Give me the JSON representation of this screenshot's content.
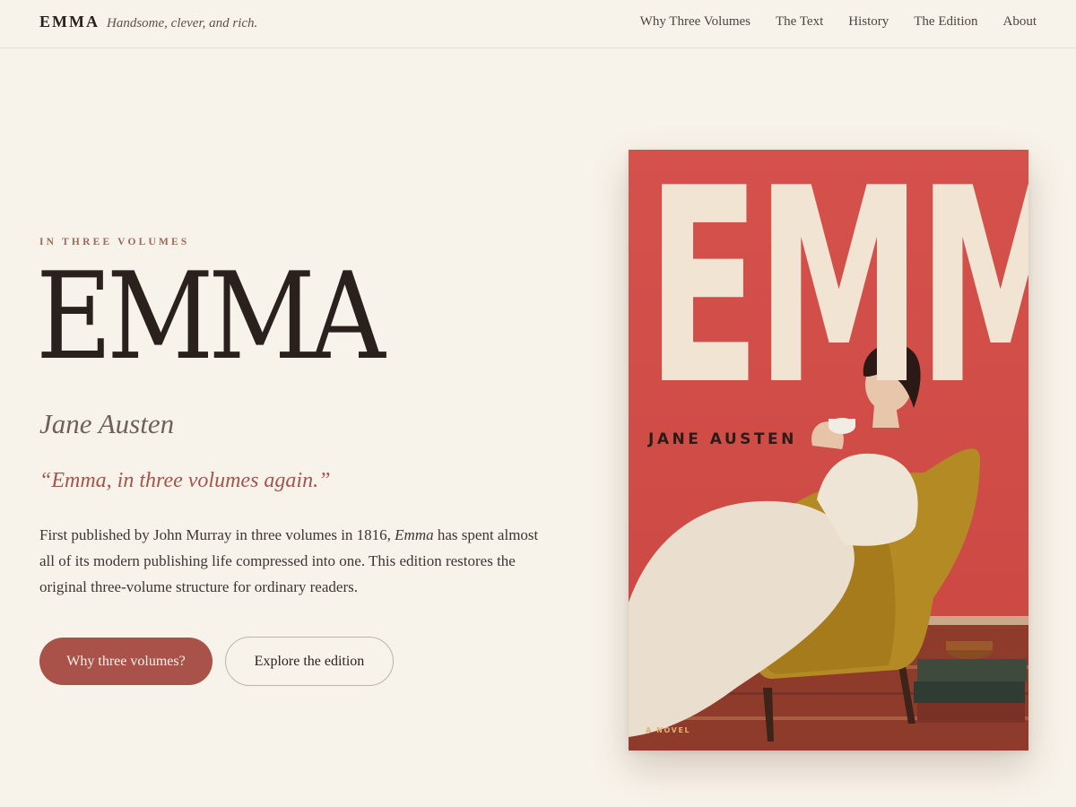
{
  "header": {
    "brand": "EMMA",
    "tagline": "Handsome, clever, and rich.",
    "nav": [
      {
        "label": "Why Three Volumes"
      },
      {
        "label": "The Text"
      },
      {
        "label": "History"
      },
      {
        "label": "The Edition"
      },
      {
        "label": "About"
      }
    ]
  },
  "hero": {
    "eyebrow": "IN THREE VOLUMES",
    "title": "EMMA",
    "author": "Jane Austen",
    "quote": "“Emma, in three volumes again.”",
    "description_before": "First published by John Murray in three volumes in 1816, ",
    "description_italic": "Emma",
    "description_after": " has spent almost all of its modern publishing life compressed into one. This edition restores the original three-volume structure for ordinary readers.",
    "primary_button": "Why three volumes?",
    "secondary_button": "Explore the edition"
  },
  "cover": {
    "title": "EMMA",
    "author": "JANE AUSTEN",
    "footer": "A NOVEL"
  },
  "colors": {
    "background": "#f8f3ea",
    "accent": "#a8524a",
    "cover_red": "#d5514c",
    "cover_cream": "#f1e4d2",
    "chair_mustard": "#b48a24"
  }
}
